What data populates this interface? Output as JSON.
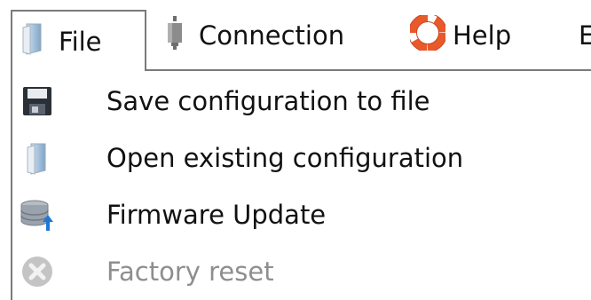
{
  "menubar": {
    "file_label": "File",
    "connection_label": "Connection",
    "help_label": "Help",
    "edit_label": "E"
  },
  "file_menu": {
    "items": [
      {
        "label": "Save configuration to file",
        "icon": "floppy-disk-icon",
        "enabled": true
      },
      {
        "label": "Open existing configuration",
        "icon": "open-folder-icon",
        "enabled": true
      },
      {
        "label": "Firmware Update",
        "icon": "firmware-update-icon",
        "enabled": true
      },
      {
        "label": "Factory reset",
        "icon": "reset-icon",
        "enabled": false
      }
    ]
  },
  "colors": {
    "text": "#111111",
    "disabled_text": "#8e8e8e",
    "border": "#7a7a7a"
  }
}
